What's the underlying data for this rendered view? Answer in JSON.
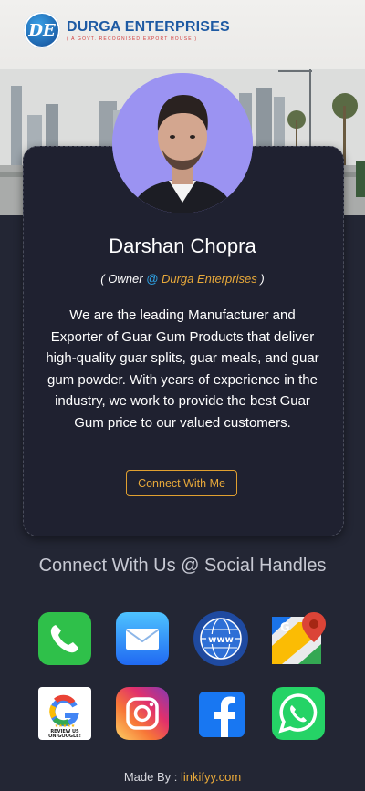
{
  "brand": {
    "logo_text": "DE",
    "name": "DURGA ENTERPRISES",
    "tagline": "( A GOVT. RECOGNISED EXPORT HOUSE )"
  },
  "profile": {
    "name": "Darshan Chopra",
    "role_prefix": "( Owner ",
    "role_at": "@",
    "role_company": " Durga Enterprises",
    "role_suffix": " )",
    "bio": "We are the leading Manufacturer and Exporter of Guar Gum Products that deliver high-quality guar splits, guar meals, and guar gum powder. With years of experience in the industry, we work to provide the best Guar Gum price to our valued customers.",
    "cta_label": "Connect With Me"
  },
  "social": {
    "title": "Connect With Us @ Social Handles",
    "icons": [
      "phone-icon",
      "email-icon",
      "website-icon",
      "google-maps-icon",
      "google-review-icon",
      "instagram-icon",
      "facebook-icon",
      "whatsapp-icon"
    ],
    "review_text_1": "REVIEW US",
    "review_text_2": "ON GOOGLE!",
    "www_text": "www"
  },
  "footer": {
    "prefix": "Made By : ",
    "link": "linkifyy.com"
  },
  "colors": {
    "background": "#232634",
    "card": "#1f2130",
    "accent": "#e8a93a",
    "link_blue": "#2fa5e8",
    "avatar_bg": "#9b93f2"
  }
}
